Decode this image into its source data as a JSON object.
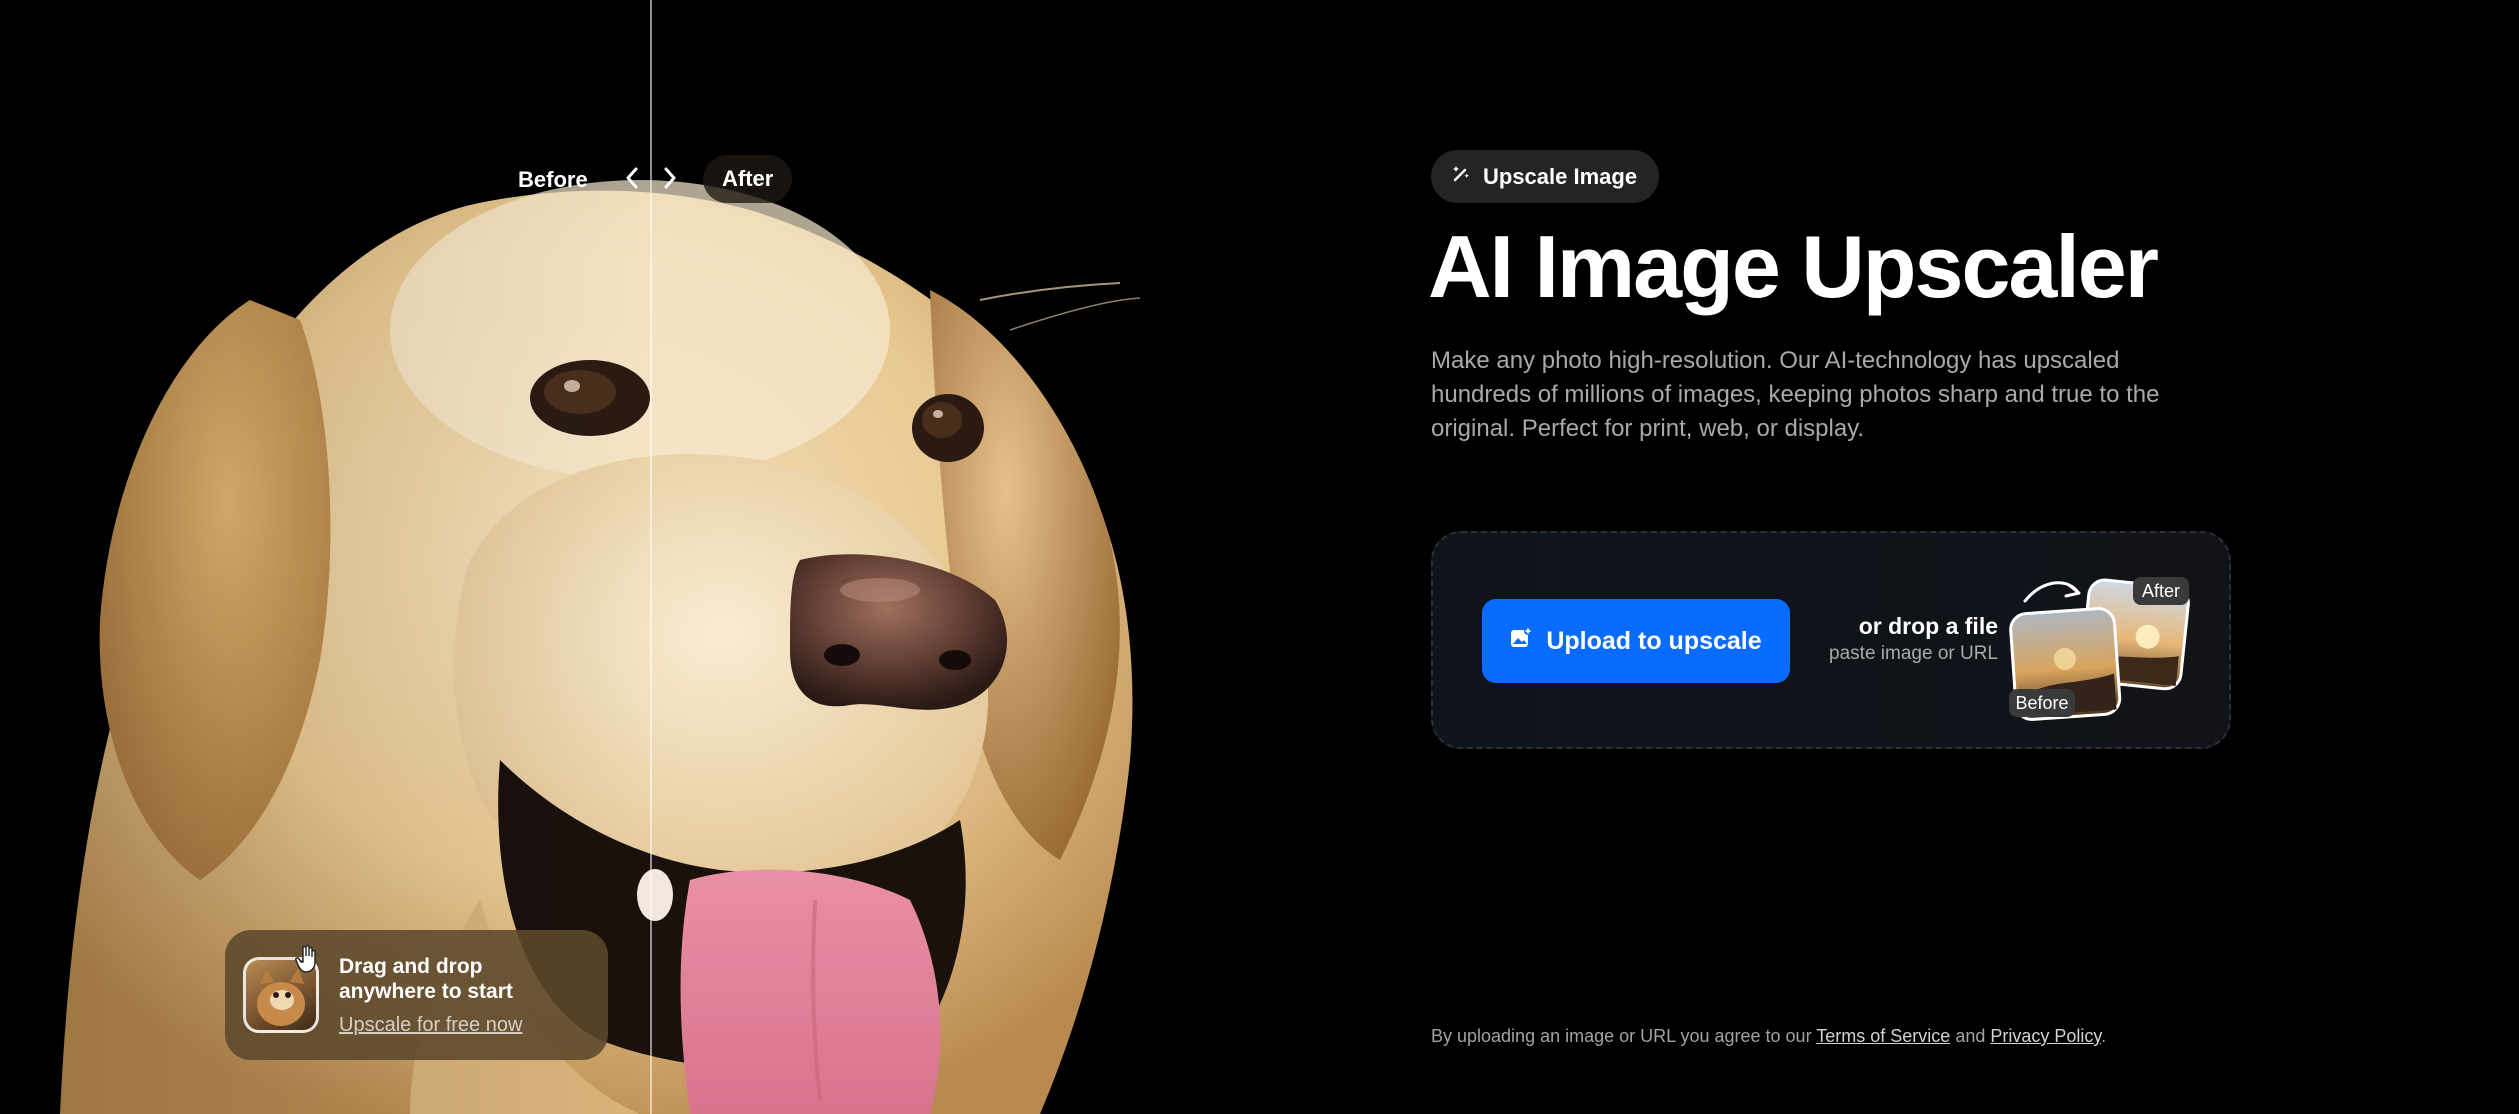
{
  "comparison": {
    "before_label": "Before",
    "after_label": "After",
    "slider_position_percent": 51
  },
  "dragdrop_card": {
    "title": "Drag and drop anywhere to start",
    "link": "Upscale for free now"
  },
  "hero": {
    "chip_label": "Upscale Image",
    "title": "AI Image Upscaler",
    "description": "Make any photo high-resolution. Our AI-technology has upscaled hundreds of millions of images, keeping photos sharp and true to the original. Perfect for print, web, or display."
  },
  "upload": {
    "button_label": "Upload to upscale",
    "drop_text": "or drop a file",
    "paste_text": "paste image or URL",
    "illustration_before": "Before",
    "illustration_after": "After"
  },
  "legal": {
    "prefix": "By uploading an image or URL you agree to our",
    "terms_link": "Terms of Service",
    "and": "and",
    "privacy_link": "Privacy Policy",
    "suffix": "."
  },
  "colors": {
    "background": "#000000",
    "accent_blue": "#0a6cff",
    "chip_bg": "#242424",
    "muted_text": "#a9a9a9"
  },
  "icons": {
    "chip": "magic-wand-icon",
    "upload": "image-plus-icon",
    "slider_left": "chevron-left-icon",
    "slider_right": "chevron-right-icon",
    "cursor": "hand-cursor-icon"
  }
}
